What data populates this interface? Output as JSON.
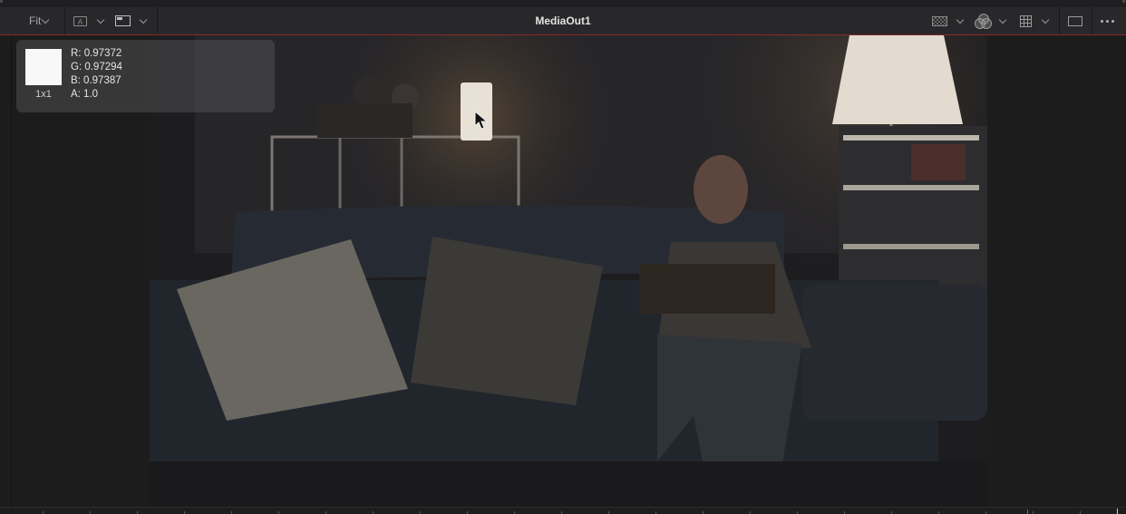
{
  "toolbar": {
    "zoom_label": "Fit",
    "title": "MediaOut1",
    "icons": [
      "channel-a-icon",
      "view-mode-icon",
      "checker-icon",
      "color-icon",
      "grid-icon",
      "rect-icon",
      "more-icon"
    ]
  },
  "pixel_info": {
    "r": "R: 0.97372",
    "g": "G: 0.97294",
    "b": "B: 0.97387",
    "a": "A: 1.0",
    "sample_size": "1x1",
    "swatch_color": "#f8f8f8"
  },
  "colors": {
    "accent_line": "#8a2a2a",
    "toolbar_bg": "#28282b",
    "panel_bg": "#1c1c1c"
  }
}
